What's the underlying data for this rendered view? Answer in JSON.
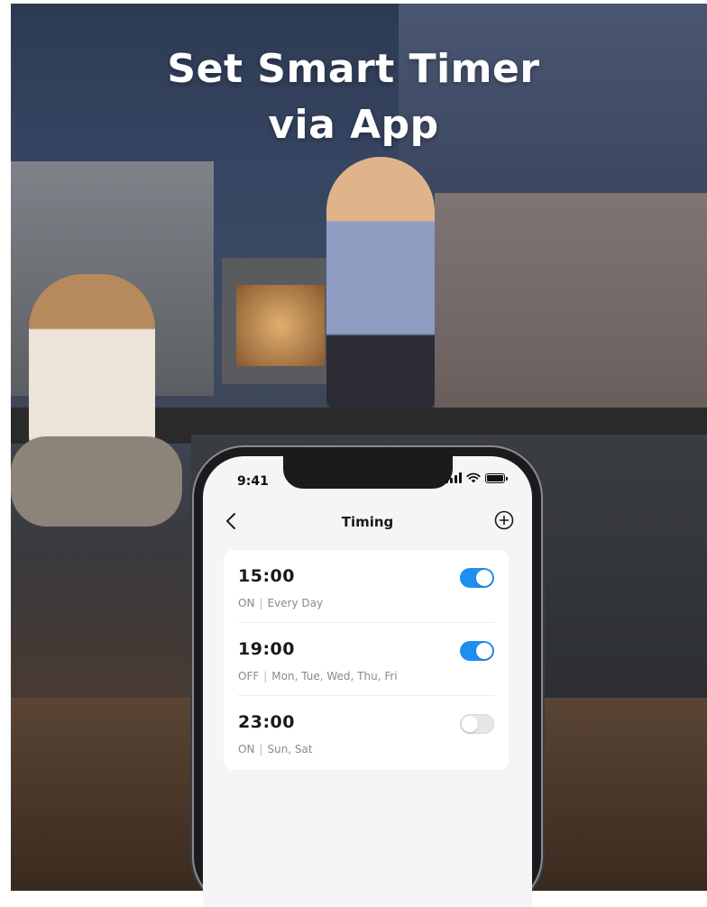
{
  "banner": {
    "line1": "Set Smart Timer",
    "line2": "via App"
  },
  "status_bar": {
    "time": "9:41"
  },
  "nav": {
    "title": "Timing",
    "back_icon": "chevron-left-icon",
    "add_icon": "plus-circle-icon"
  },
  "timers": [
    {
      "time": "15:00",
      "action": "ON",
      "separator": "|",
      "days": "Every Day",
      "enabled": true
    },
    {
      "time": "19:00",
      "action": "OFF",
      "separator": "|",
      "days": "Mon, Tue, Wed, Thu, Fri",
      "enabled": true
    },
    {
      "time": "23:00",
      "action": "ON",
      "separator": "|",
      "days": "Sun, Sat",
      "enabled": false
    }
  ],
  "colors": {
    "toggle_on": "#1e8ff0",
    "toggle_off": "#e7e7ea",
    "screen_bg": "#f5f5f7"
  }
}
